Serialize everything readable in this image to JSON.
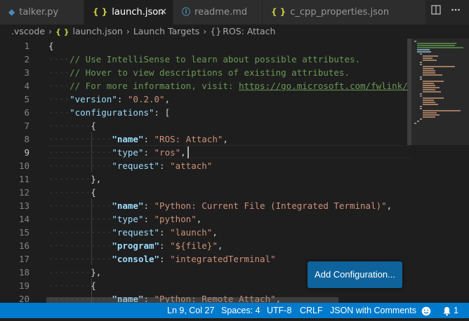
{
  "tabs": [
    {
      "name": "talker.py",
      "icon": "python-icon",
      "glyph": "◆",
      "color": "#4b8bbe"
    },
    {
      "name": "launch.json",
      "icon": "json-braces-icon",
      "glyph": "{ }",
      "color": "#cbcb41"
    },
    {
      "name": "readme.md",
      "icon": "info-icon",
      "glyph": "ⓘ",
      "color": "#519aba"
    },
    {
      "name": "c_cpp_properties.json",
      "icon": "json-braces-icon",
      "glyph": "{ }",
      "color": "#cbcb41"
    }
  ],
  "tab_close": "✕",
  "breadcrumb": {
    "folder": ".vscode",
    "file": "launch.json",
    "section": "Launch Targets",
    "item": "ROS: Attach",
    "item_icon": "{}"
  },
  "line_numbers": [
    "1",
    "2",
    "3",
    "4",
    "5",
    "6",
    "7",
    "8",
    "9",
    "10",
    "11",
    "12",
    "13",
    "14",
    "15",
    "16",
    "17",
    "18",
    "19",
    "20"
  ],
  "code": {
    "c2": "// Use IntelliSense to learn about possible attributes.",
    "c3": "// Hover to view descriptions of existing attributes.",
    "c4": "// For more information, visit: ",
    "c4url": "https://go.microsoft.com/fwlink/",
    "name_key": "\"name\"",
    "type_key": "\"type\"",
    "request_key": "\"request\"",
    "program_key": "\"program\"",
    "console_key": "\"console\"",
    "version_key": "\"version\"",
    "configs_key": "\"configurations\"",
    "version_val": "\"0.2.0\"",
    "v_ros_attach": "\"ROS: Attach\"",
    "v_ros": "\"ros\"",
    "v_attach": "\"attach\"",
    "v_python_current": "\"Python: Current File (Integrated Terminal)\"",
    "v_python": "\"python\"",
    "v_launch": "\"launch\"",
    "v_file": "\"${file}\"",
    "v_integrated": "\"integratedTerminal\"",
    "v_python_remote": "\"Python: Remote Attach\""
  },
  "add_config_button": "Add Configuration...",
  "status": {
    "position": "Ln 9, Col 27",
    "spaces": "Spaces: 4",
    "encoding": "UTF-8",
    "eol": "CRLF",
    "language": "JSON with Comments",
    "notifications": "1"
  },
  "colors": {
    "statusbar": "#007acc",
    "button": "#0e639c",
    "editor_bg": "#1e1e1e"
  }
}
